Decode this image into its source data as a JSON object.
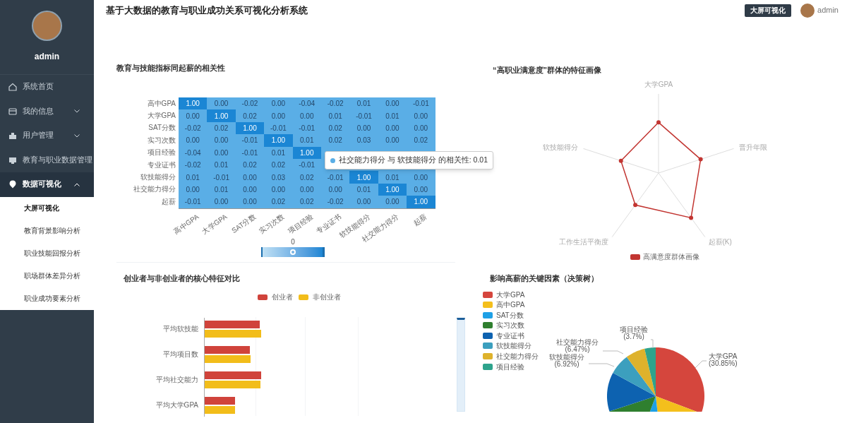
{
  "sidebar": {
    "user": {
      "name": "admin"
    },
    "menu": [
      {
        "label": "系统首页",
        "selected": false
      },
      {
        "label": "我的信息",
        "selected": false,
        "expanded": false
      },
      {
        "label": "用户管理",
        "selected": false,
        "expanded": false
      },
      {
        "label": "教育与职业数据管理",
        "selected": false
      },
      {
        "label": "数据可视化",
        "selected": true,
        "expanded": true,
        "children": [
          {
            "label": "大屏可视化",
            "selected": true
          },
          {
            "label": "教育背景影响分析",
            "selected": false
          },
          {
            "label": "职业技能回报分析",
            "selected": false
          },
          {
            "label": "职场群体差异分析",
            "selected": false
          },
          {
            "label": "职业成功要素分析",
            "selected": false
          }
        ]
      }
    ]
  },
  "header": {
    "title": "基于大数据的教育与职业成功关系可视化分析系统",
    "button": "大屏可视化",
    "user": "admin"
  },
  "heatmap": {
    "title": "教育与技能指标同起薪的相关性",
    "row_labels": [
      "高中GPA",
      "大学GPA",
      "SAT分数",
      "实习次数",
      "项目经验",
      "专业证书",
      "软技能得分",
      "社交能力得分",
      "起薪"
    ],
    "column_labels": [
      "高中GPA",
      "大学GPA",
      "SAT分数",
      "实习次数",
      "项目经验",
      "专业证书",
      "软技能得分",
      "社交能力得分",
      "起薪"
    ],
    "cells": [
      [
        "1.00",
        "0.00",
        "-0.02",
        "0.00",
        "-0.04",
        "-0.02",
        "0.01",
        "0.00",
        "-0.01"
      ],
      [
        "0.00",
        "1.00",
        "0.02",
        "0.00",
        "0.00",
        "0.01",
        "-0.01",
        "0.01",
        "0.00"
      ],
      [
        "-0.02",
        "0.02",
        "1.00",
        "-0.01",
        "-0.01",
        "0.02",
        "0.00",
        "0.00",
        "0.00"
      ],
      [
        "0.00",
        "0.00",
        "-0.01",
        "1.00",
        "0.01",
        "0.02",
        "0.03",
        "0.00",
        "0.02"
      ],
      [
        "-0.04",
        "0.00",
        "-0.01",
        "0.01",
        "1.00",
        null,
        null,
        null,
        null
      ],
      [
        "-0.02",
        "0.01",
        "0.02",
        "0.02",
        "-0.01",
        null,
        null,
        null,
        null
      ],
      [
        "0.01",
        "-0.01",
        "0.00",
        "0.03",
        "0.02",
        "-0.01",
        "1.00",
        "0.01",
        "0.00"
      ],
      [
        "0.00",
        "0.01",
        "0.00",
        "0.00",
        "0.00",
        "0.00",
        "0.01",
        "1.00",
        "0.00"
      ],
      [
        "-0.01",
        "0.00",
        "0.00",
        "0.02",
        "0.02",
        "-0.02",
        "0.00",
        "0.00",
        "1.00"
      ]
    ],
    "tooltip": {
      "text": "社交能力得分 与 软技能得分 的相关性: 0.01"
    },
    "visual_map": {
      "label": "0",
      "level": 0.5
    }
  },
  "radar": {
    "title": "“高职业满意度”群体的特征画像",
    "axes": [
      "大学GPA",
      "软技能得分",
      "晋升年限",
      "工作生活平衡度",
      "起薪(K)"
    ],
    "legend": {
      "label": "高满意度群体画像",
      "color": "#c23531"
    }
  },
  "bar_chart": {
    "title": "创业者与非创业者的核心特征对比",
    "series": [
      {
        "name": "创业者",
        "color": "#d0433b"
      },
      {
        "name": "非创业者",
        "color": "#f2bd1a"
      }
    ],
    "categories": [
      "平均软技能",
      "平均项目数",
      "平均社交能力",
      "平均大学GPA"
    ],
    "zoom_slider": {
      "level": 1
    }
  },
  "pie_chart": {
    "title": "影响高薪的关键因素（决策树）",
    "legend": [
      {
        "label": "大学GPA",
        "color": "#d5463d"
      },
      {
        "label": "高中GPA",
        "color": "#f4bf1c"
      },
      {
        "label": "SAT分数",
        "color": "#1ea0e6"
      },
      {
        "label": "实习次数",
        "color": "#2f7f2f"
      },
      {
        "label": "专业证书",
        "color": "#0d62b0"
      },
      {
        "label": "软技能得分",
        "color": "#3c9fbe"
      },
      {
        "label": "社交能力得分",
        "color": "#deb22c"
      },
      {
        "label": "项目经验",
        "color": "#2ea38c"
      }
    ],
    "slice_labels": [
      {
        "name": "项目经验",
        "percent": "(3.7%)"
      },
      {
        "name": "社交能力得分",
        "percent": "(6.47%)"
      },
      {
        "name": "软技能得分",
        "percent": "(6.92%)"
      },
      {
        "name": "大学GPA",
        "percent": "(30.85%)"
      }
    ]
  }
}
